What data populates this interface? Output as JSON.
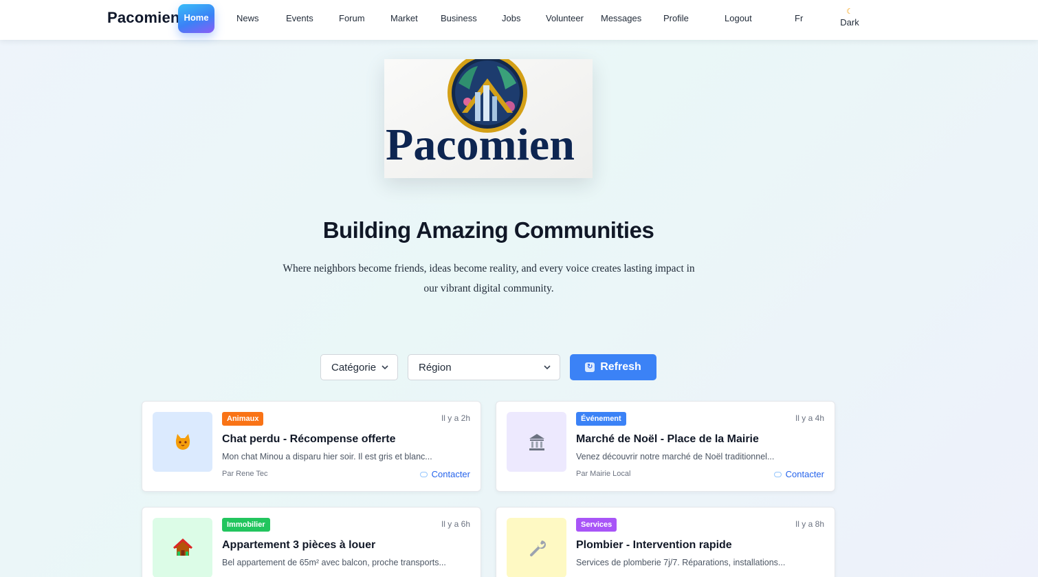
{
  "nav": {
    "brand": "Pacomien",
    "home": "Home",
    "links": {
      "news": "News",
      "events": "Events",
      "forum": "Forum",
      "market": "Market",
      "business": "Business",
      "jobs": "Jobs",
      "volunteer": "Volunteer",
      "messages": "Messages",
      "profile": "Profile",
      "logout": "Logout",
      "lang": "Fr"
    },
    "dark": {
      "icon": "moon-icon",
      "label": "Dark"
    }
  },
  "hero": {
    "logo_text": "Pacomien",
    "title": "Building Amazing Communities",
    "subtitle": "Where neighbors become friends, ideas become reality, and every voice creates lasting impact in our vibrant digital community."
  },
  "filters": {
    "category": "Catégorie",
    "region": "Région",
    "refresh": "Refresh"
  },
  "cards": [
    {
      "badge": "Animaux",
      "badge_color": "#f97316",
      "time": "Il y a 2h",
      "title": "Chat perdu - Récompense offerte",
      "desc": "Mon chat Minou a disparu hier soir. Il est gris et blanc...",
      "author": "Par Rene Tec",
      "contact": "Contacter",
      "icon": "cat-icon",
      "thumb_bg": "#dbeafe"
    },
    {
      "badge": "Événement",
      "badge_color": "#3b82f6",
      "time": "Il y a 4h",
      "title": "Marché de Noël - Place de la Mairie",
      "desc": "Venez découvrir notre marché de Noël traditionnel...",
      "author": "Par Mairie Local",
      "contact": "Contacter",
      "icon": "building-icon",
      "thumb_bg": "#ede9fe"
    },
    {
      "badge": "Immobilier",
      "badge_color": "#22c55e",
      "time": "Il y a 6h",
      "title": "Appartement 3 pièces à louer",
      "desc": "Bel appartement de 65m² avec balcon, proche transports...",
      "author": "",
      "contact": "",
      "icon": "house-icon",
      "thumb_bg": "#dcfce7"
    },
    {
      "badge": "Services",
      "badge_color": "#a855f7",
      "time": "Il y a 8h",
      "title": "Plombier - Intervention rapide",
      "desc": "Services de plomberie 7j/7. Réparations, installations...",
      "author": "",
      "contact": "",
      "icon": "wrench-icon",
      "thumb_bg": "#fef9c3"
    }
  ]
}
